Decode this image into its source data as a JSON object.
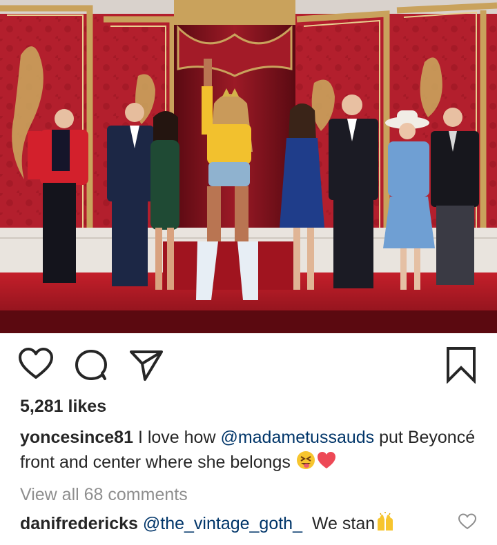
{
  "post": {
    "photo_icon": "wax-figures-photo",
    "likes": "5,281 likes",
    "caption": {
      "username": "yoncesince81",
      "text_1": " I love how ",
      "mention": "@madametussauds",
      "text_2": " put Beyoncé front and center where she belongs ",
      "emojis": [
        "squinting-tongue-face",
        "red-heart"
      ]
    },
    "view_all_comments": "View all 68 comments",
    "comment": {
      "username": "danifredericks",
      "mention": "@the_vintage_goth_",
      "text": "  We stan",
      "emoji": "raising-hands"
    }
  },
  "icons": {
    "like": "heart-outline-icon",
    "comment": "speech-bubble-icon",
    "share": "paper-plane-icon",
    "save": "bookmark-icon",
    "comment_like": "small-heart-icon"
  },
  "colors": {
    "text": "#262626",
    "mention": "#003569",
    "muted": "#8e8e8e",
    "heart": "#ed4956",
    "wall": "#b01e2c",
    "gold": "#c9a25c"
  }
}
